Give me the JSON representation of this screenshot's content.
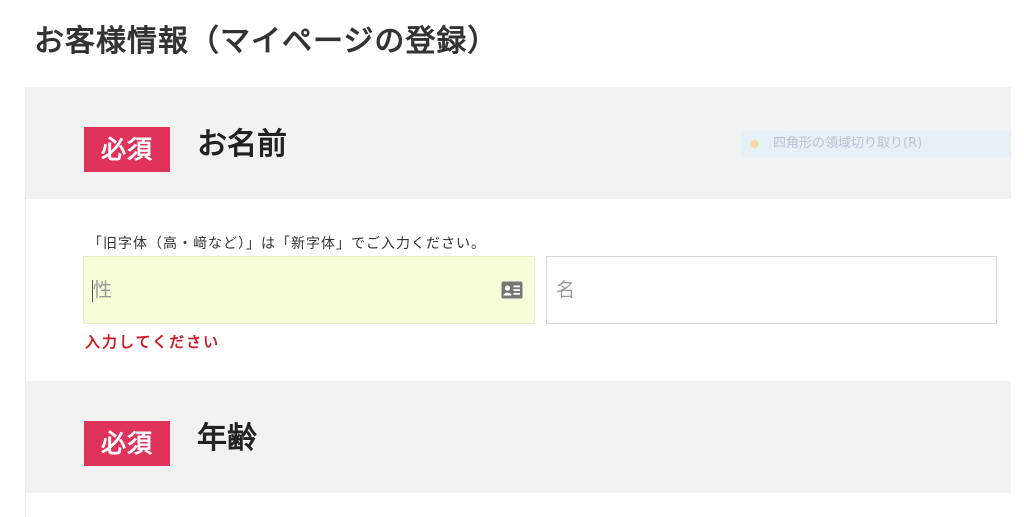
{
  "page": {
    "title": "お客様情報（マイページの登録）"
  },
  "sections": [
    {
      "badge": "必須",
      "title": "お名前",
      "note": "「旧字体（高・﨑など）」は「新字体」でご入力ください。",
      "fields": {
        "last_name": {
          "placeholder": "性",
          "value": ""
        },
        "first_name": {
          "placeholder": "名",
          "value": ""
        }
      },
      "error": "入力してください"
    },
    {
      "badge": "必須",
      "title": "年齢"
    }
  ],
  "overlay": {
    "tooltip": "四角形の領域切り取り(R)"
  },
  "icons": {
    "autofill": "contact-card-icon"
  },
  "colors": {
    "badge_bg": "#e0335b",
    "error_text": "#cc1a28",
    "section_header_bg": "#f2f2f2",
    "autofill_input_bg": "#f6fdd8"
  }
}
